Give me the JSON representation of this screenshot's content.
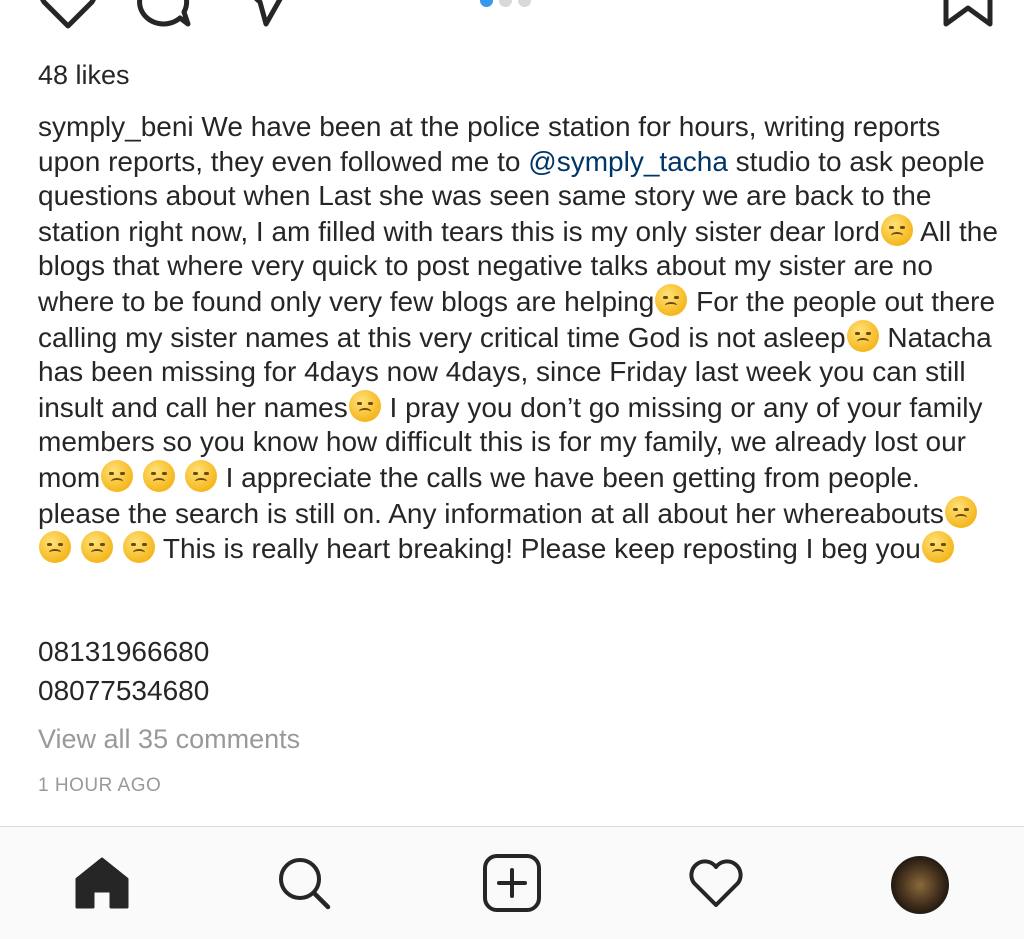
{
  "post": {
    "likes": "48 likes",
    "username": "symply_beni",
    "caption_parts": {
      "p1": " We have been at the police station for hours, writing reports upon reports, they even followed me to ",
      "mention": "@symply_tacha",
      "p2": " studio to ask people questions about when Last she was seen same story we are back to the station right now, I am filled with tears this is my only sister dear lord",
      "p3": " All the blogs that where very quick to post negative talks about my sister are no where to be found only very few blogs are helping",
      "p4": " For the people out there calling my sister names at this very critical time God is not asleep",
      "p5": " Natacha has been missing for 4days now 4days, since Friday last week you can still insult and call her names",
      "p6": " I pray you don’t go missing or any of your family members so you know how difficult this is for my family, we already lost our mom",
      "p7": " I appreciate the calls we have been getting from people. please the search is still on. Any information at all about her whereabouts",
      "p8": " This is really heart breaking! Please keep reposting I beg you"
    },
    "phone_1": "08131966680",
    "phone_2": "08077534680",
    "view_comments": "View all 35 comments",
    "timestamp": "1 HOUR AGO"
  },
  "carousel": {
    "total_dots": 3,
    "active_index": 0
  },
  "icons": {
    "top": [
      "heart-icon",
      "comment-icon",
      "share-icon",
      "bookmark-icon"
    ],
    "tabbar": [
      "home-icon",
      "search-icon",
      "add-post-icon",
      "activity-heart-icon",
      "profile-avatar"
    ]
  },
  "colors": {
    "text": "#262626",
    "mention": "#003569",
    "muted": "#999999",
    "accent": "#3897f0",
    "tabbar_bg": "#fafafa"
  }
}
